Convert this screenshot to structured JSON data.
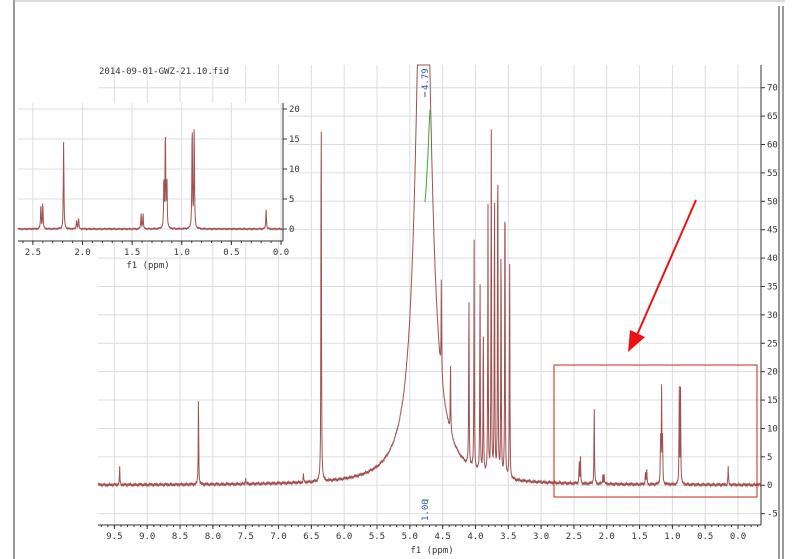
{
  "chart_data": [
    {
      "type": "line",
      "title": "2014-09-01-GWZ-21.10.fid",
      "xlabel": "f1 (ppm)",
      "ylabel": "",
      "xlim": [
        9.75,
        -0.35
      ],
      "ylim": [
        -7,
        74
      ],
      "x_reversed": true,
      "grid": true,
      "xticks": [
        "9.5",
        "9.0",
        "8.5",
        "8.0",
        "7.5",
        "7.0",
        "6.5",
        "6.0",
        "5.5",
        "5.0",
        "4.5",
        "4.0",
        "3.5",
        "3.0",
        "2.5",
        "2.0",
        "1.5",
        "1.0",
        "0.5",
        "0.0"
      ],
      "yticks": [
        "-5",
        "0",
        "5",
        "10",
        "15",
        "20",
        "25",
        "30",
        "35",
        "40",
        "45",
        "50",
        "55",
        "60",
        "65",
        "70"
      ],
      "integral_label": "1.00",
      "peak_label": "4.79",
      "peaks": [
        {
          "ppm": 9.42,
          "height": 3.2
        },
        {
          "ppm": 8.22,
          "height": 16
        },
        {
          "ppm": 7.5,
          "height": 1.2
        },
        {
          "ppm": 6.62,
          "height": 1.6
        },
        {
          "ppm": 6.35,
          "height": 75
        },
        {
          "ppm": 4.79,
          "height": 75
        },
        {
          "ppm": 4.52,
          "height": 17
        },
        {
          "ppm": 4.38,
          "height": 13
        },
        {
          "ppm": 4.1,
          "height": 32
        },
        {
          "ppm": 4.02,
          "height": 41
        },
        {
          "ppm": 3.93,
          "height": 36
        },
        {
          "ppm": 3.88,
          "height": 28
        },
        {
          "ppm": 3.81,
          "height": 48
        },
        {
          "ppm": 3.76,
          "height": 65
        },
        {
          "ppm": 3.71,
          "height": 55
        },
        {
          "ppm": 3.66,
          "height": 65
        },
        {
          "ppm": 3.61,
          "height": 47
        },
        {
          "ppm": 3.55,
          "height": 59
        },
        {
          "ppm": 3.48,
          "height": 41
        },
        {
          "ppm": 2.42,
          "height": 4.2
        },
        {
          "ppm": 2.4,
          "height": 4.4
        },
        {
          "ppm": 2.19,
          "height": 14.5
        },
        {
          "ppm": 2.06,
          "height": 1.5
        },
        {
          "ppm": 2.04,
          "height": 1.9
        },
        {
          "ppm": 1.41,
          "height": 2.5
        },
        {
          "ppm": 1.39,
          "height": 2.6
        },
        {
          "ppm": 1.18,
          "height": 8.2
        },
        {
          "ppm": 1.165,
          "height": 16.5
        },
        {
          "ppm": 1.15,
          "height": 8.4
        },
        {
          "ppm": 0.895,
          "height": 17.5
        },
        {
          "ppm": 0.875,
          "height": 17.2
        },
        {
          "ppm": 0.15,
          "height": 3.4
        }
      ]
    },
    {
      "type": "line",
      "title": "",
      "xlabel": "f1 (ppm)",
      "ylabel": "",
      "xlim": [
        2.65,
        -0.02
      ],
      "ylim": [
        -2,
        21
      ],
      "x_reversed": true,
      "grid": true,
      "xticks": [
        "2.5",
        "2.0",
        "1.5",
        "1.0",
        "0.5",
        "0.0"
      ],
      "yticks": [
        "0",
        "5",
        "10",
        "15",
        "20"
      ],
      "peaks": [
        {
          "ppm": 2.42,
          "height": 4.2
        },
        {
          "ppm": 2.4,
          "height": 4.4
        },
        {
          "ppm": 2.19,
          "height": 14.5
        },
        {
          "ppm": 2.06,
          "height": 1.5
        },
        {
          "ppm": 2.04,
          "height": 1.9
        },
        {
          "ppm": 1.41,
          "height": 2.5
        },
        {
          "ppm": 1.39,
          "height": 2.6
        },
        {
          "ppm": 1.18,
          "height": 8.2
        },
        {
          "ppm": 1.165,
          "height": 16.5
        },
        {
          "ppm": 1.15,
          "height": 8.4
        },
        {
          "ppm": 0.895,
          "height": 17.5
        },
        {
          "ppm": 0.875,
          "height": 17.2
        },
        {
          "ppm": 0.15,
          "height": 3.4
        }
      ]
    }
  ],
  "colors": {
    "spectrum": "#a05050",
    "highlight": "#cc2222",
    "arrow": "#ee1111",
    "integral": "#3355aa",
    "integral_curve": "#33aa33"
  }
}
